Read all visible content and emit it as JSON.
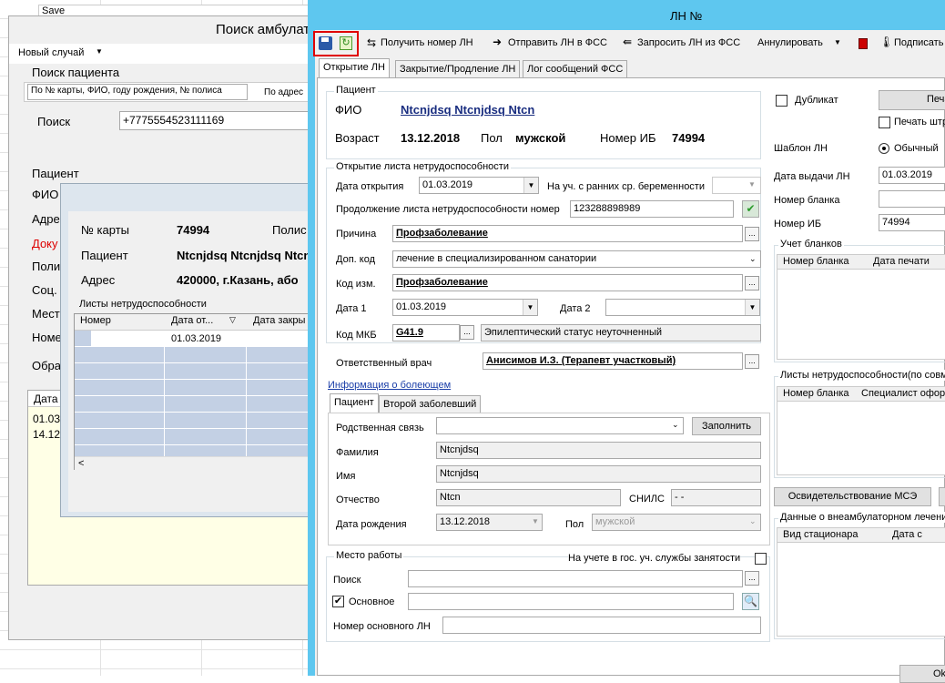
{
  "bg": {
    "save": "Save",
    "title": "Поиск амбулат",
    "new_case": "Новый случай",
    "search_patient": "Поиск пациента",
    "search_mode": "По № карты, ФИО, году рождения, № полиса",
    "search_mode2": "По адрес",
    "search_label": "Поиск",
    "search_value": "+7775554523111169",
    "patient_group": "Пациент",
    "left_labels": [
      "ФИО",
      "Адре",
      "Доку",
      "Поли",
      "Соц.",
      "Мест",
      "Номе"
    ],
    "obr": "Обра",
    "data_hdr": "Дата",
    "d1": "01.03",
    "d2": "14.12"
  },
  "mid": {
    "card_lbl": "№ карты",
    "card_val": "74994",
    "polis_lbl": "Полис",
    "patient_lbl": "Пациент",
    "patient_val": "Ntcnjdsq Ntcnjdsq Ntcn",
    "addr_lbl": "Адрес",
    "addr_val": "420000, г.Казань, або",
    "list_title": "Листы нетрудоспособности",
    "cols": [
      "Номер",
      "Дата от...",
      "Дата закры"
    ],
    "row_date": "01.03.2019"
  },
  "win": {
    "title": "ЛН №",
    "toolbar": {
      "get": "Получить номер ЛН",
      "send": "Отправить ЛН в ФСС",
      "request": "Запросить ЛН из ФСС",
      "cancel": "Аннулировать",
      "sign": "Подписать"
    },
    "tabs": [
      "Открытие ЛН",
      "Закрытие/Продление ЛН",
      "Лог сообщений ФСС"
    ],
    "patient": {
      "group": "Пациент",
      "fio_lbl": "ФИО",
      "fio": "Ntcnjdsq Ntcnjdsq Ntcn",
      "age_lbl": "Возраст",
      "age": "13.12.2018",
      "sex_lbl": "Пол",
      "sex": "мужской",
      "ib_lbl": "Номер ИБ",
      "ib": "74994"
    },
    "open": {
      "group": "Открытие листа нетрудоспособности",
      "date_lbl": "Дата открытия",
      "date": "01.03.2019",
      "early_lbl": "На уч. с ранних ср. беременности",
      "cont_lbl": "Продолжение листа нетрудоспособности номер",
      "cont": "123288898989",
      "reason_lbl": "Причина",
      "reason": "Профзаболевание",
      "dop_lbl": "Доп. код",
      "dop": "лечение в специализированном санатории",
      "izm_lbl": "Код изм.",
      "izm": "Профзаболевание",
      "d1_lbl": "Дата 1",
      "d1": "01.03.2019",
      "d2_lbl": "Дата 2",
      "mkb_lbl": "Код МКБ",
      "mkb": "G41.9",
      "mkb_text": "Эпилептический статус неуточненный"
    },
    "doctor_lbl": "Ответственный врач",
    "doctor": "Анисимов И.З. (Терапевт участковый)",
    "info_link": "Информация о болеющем",
    "subtabs": [
      "Пациент",
      "Второй заболевший"
    ],
    "sick": {
      "rel_lbl": "Родственная связь",
      "fill": "Заполнить",
      "fam_lbl": "Фамилия",
      "fam": "Ntcnjdsq",
      "name_lbl": "Имя",
      "name": "Ntcnjdsq",
      "otch_lbl": "Отчество",
      "otch": "Ntcn",
      "snils_lbl": "СНИЛС",
      "snils": "-  -",
      "bd_lbl": "Дата рождения",
      "bd": "13.12.2018",
      "sex_lbl": "Пол",
      "sex": "мужской"
    },
    "work": {
      "group": "Место работы",
      "employ": "На учете в гос. уч. службы занятости",
      "search_lbl": "Поиск",
      "main_lbl": "Основное",
      "mainln_lbl": "Номер основного ЛН"
    },
    "right": {
      "dup": "Дубликат",
      "print": "Печа",
      "print_str": "Печать штр",
      "tpl_lbl": "Шаблон ЛН",
      "tpl": "Обычный",
      "issue_lbl": "Дата выдачи ЛН",
      "issue": "01.03.2019",
      "blank_lbl": "Номер бланка",
      "ib_lbl": "Номер ИБ",
      "ib": "74994",
      "blanks_group": "Учет бланков",
      "blanks_cols": [
        "Номер бланка",
        "Дата печати"
      ],
      "lists_group": "Листы нетрудоспособности(по совм",
      "lists_cols": [
        "Номер бланка",
        "Специалист офор"
      ],
      "mse": "Освидетельствование МСЭ",
      "hosp_group": "Данные о внеамбулаторном лечени",
      "hosp_cols": [
        "Вид стационара",
        "Дата с"
      ],
      "ok": "Ok"
    }
  }
}
